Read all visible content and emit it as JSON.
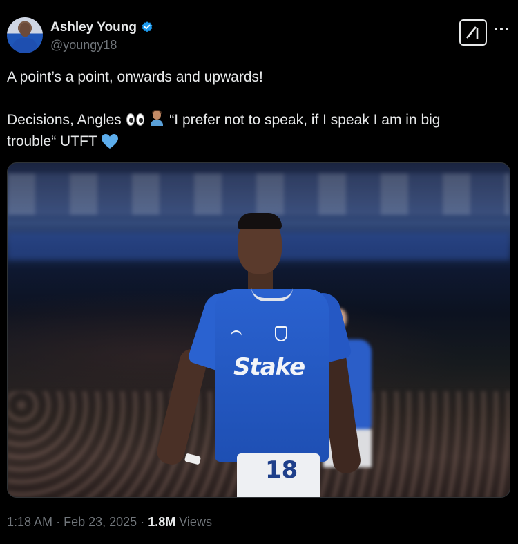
{
  "author": {
    "name": "Ashley Young",
    "handle": "@youngy18",
    "verified_color": "#1d9bf0"
  },
  "icons": {
    "verified": "verified-badge-icon",
    "grok": "grok-icon",
    "more": "more-icon"
  },
  "tweet": {
    "line1": "A point’s a point, onwards and upwards!",
    "line2_prefix": "Decisions, Angles",
    "line2_emojis": [
      "eyes-emoji",
      "person-shrugging-emoji"
    ],
    "line2_quote": "“I prefer not to speak, if I speak I am in big",
    "line3_text": "trouble“ UTFT",
    "line3_emoji": "blue-heart-emoji"
  },
  "photo": {
    "sponsor_text": "Stake",
    "shirt_number": "18"
  },
  "meta": {
    "time": "1:18 AM",
    "separator": "·",
    "date": "Feb 23, 2025",
    "views_count": "1.8M",
    "views_label": "Views"
  },
  "colors": {
    "background": "#000000",
    "text": "#e7e9ea",
    "muted": "#71767b",
    "accent": "#1d9bf0"
  }
}
